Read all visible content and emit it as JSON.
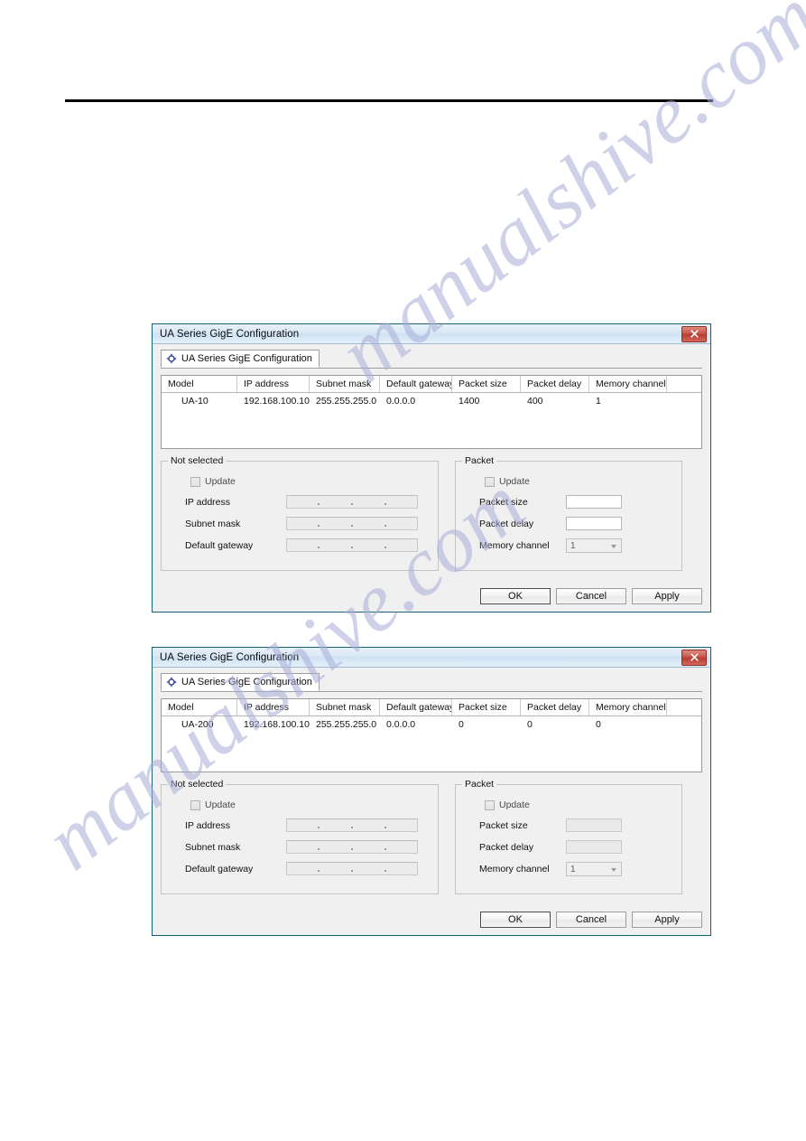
{
  "page": {
    "watermark_line1": "manualshive.com",
    "watermark_line2": "manualshive.com"
  },
  "dialogs": [
    {
      "title": "UA Series GigE Configuration",
      "close_icon": "close-icon",
      "tab": {
        "label": "UA Series GigE Configuration",
        "icon": "gige-config-icon"
      },
      "table": {
        "columns": [
          "Model",
          "IP address",
          "Subnet mask",
          "Default gateway",
          "Packet size",
          "Packet delay",
          "Memory channel"
        ],
        "rows": [
          [
            "UA-10",
            "192.168.100.10",
            "255.255.255.0",
            "0.0.0.0",
            "1400",
            "400",
            "1"
          ]
        ]
      },
      "network_group": {
        "title": "Not selected",
        "update_label": "Update",
        "update_checked": false,
        "fields": [
          {
            "label": "IP address",
            "value": ""
          },
          {
            "label": "Subnet mask",
            "value": ""
          },
          {
            "label": "Default gateway",
            "value": ""
          }
        ]
      },
      "packet_group": {
        "title": "Packet",
        "update_label": "Update",
        "update_checked": false,
        "packet_size_label": "Packet size",
        "packet_size_value": "",
        "packet_size_disabled": false,
        "packet_delay_label": "Packet delay",
        "packet_delay_value": "",
        "packet_delay_disabled": false,
        "memory_channel_label": "Memory channel",
        "memory_channel_value": "1"
      },
      "buttons": {
        "ok": "OK",
        "cancel": "Cancel",
        "apply": "Apply"
      }
    },
    {
      "title": "UA Series GigE Configuration",
      "close_icon": "close-icon",
      "tab": {
        "label": "UA Series GigE Configuration",
        "icon": "gige-config-icon"
      },
      "table": {
        "columns": [
          "Model",
          "IP address",
          "Subnet mask",
          "Default gateway",
          "Packet size",
          "Packet delay",
          "Memory channel"
        ],
        "rows": [
          [
            "UA-200",
            "192.168.100.10",
            "255.255.255.0",
            "0.0.0.0",
            "0",
            "0",
            "0"
          ]
        ]
      },
      "network_group": {
        "title": "Not selected",
        "update_label": "Update",
        "update_checked": false,
        "fields": [
          {
            "label": "IP address",
            "value": ""
          },
          {
            "label": "Subnet mask",
            "value": ""
          },
          {
            "label": "Default gateway",
            "value": ""
          }
        ]
      },
      "packet_group": {
        "title": "Packet",
        "update_label": "Update",
        "update_checked": false,
        "packet_size_label": "Packet size",
        "packet_size_value": "",
        "packet_size_disabled": true,
        "packet_delay_label": "Packet delay",
        "packet_delay_value": "",
        "packet_delay_disabled": true,
        "memory_channel_label": "Memory channel",
        "memory_channel_value": "1"
      },
      "buttons": {
        "ok": "OK",
        "cancel": "Cancel",
        "apply": "Apply"
      }
    }
  ]
}
